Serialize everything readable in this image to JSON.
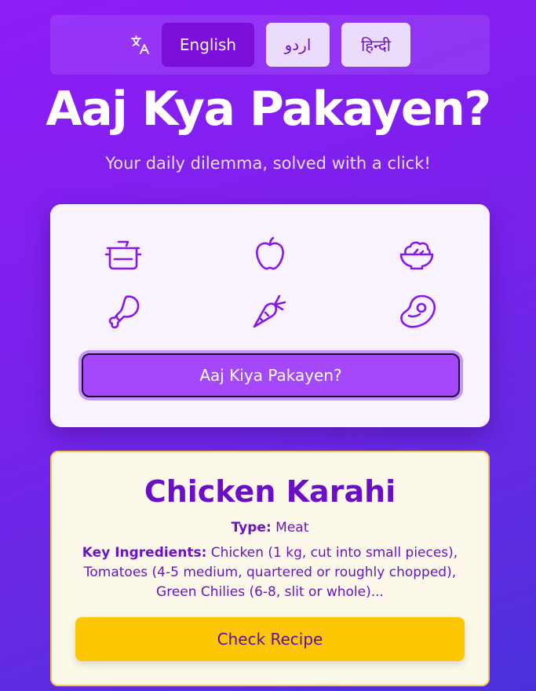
{
  "language_bar": {
    "icon": "translate-icon",
    "options": [
      "English",
      "اردو",
      "हिन्दी"
    ],
    "selected": "English"
  },
  "header": {
    "title": "Aaj Kya Pakayen?",
    "subtitle": "Your daily dilemma, solved with a click!"
  },
  "picker": {
    "icons": [
      "cooking-pot-icon",
      "apple-icon",
      "salad-bowl-icon",
      "drumstick-icon",
      "carrot-icon",
      "steak-icon"
    ],
    "button_label": "Aaj Kiya Pakayen?"
  },
  "result": {
    "dish_name": "Chicken Karahi",
    "type_label": "Type:",
    "type_value": "Meat",
    "ingredients_label": "Key Ingredients:",
    "ingredients_value": "Chicken (1 kg, cut into small pieces), Tomatoes (4-5 medium, quartered or roughly chopped), Green Chilies (6-8, slit or whole)...",
    "recipe_button": "Check Recipe"
  },
  "colors": {
    "accent": "#7d0dd8",
    "icon_stroke": "#8a16e8",
    "recipe_button": "#fcc603",
    "result_border": "#f5c44a"
  }
}
